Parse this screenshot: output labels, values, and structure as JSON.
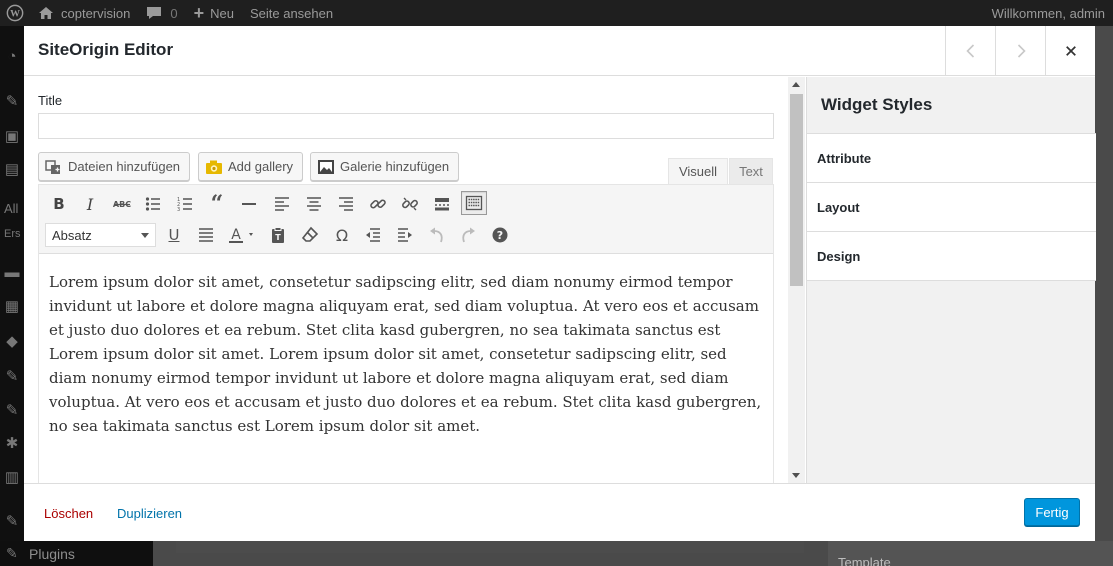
{
  "admin_bar": {
    "site_name": "coptervision",
    "comments_count": "0",
    "new_label": "Neu",
    "view_site_label": "Seite ansehen",
    "greeting": "Willkommen, admin"
  },
  "background": {
    "menu_text_all": "All",
    "menu_text_ers": "Ers",
    "plugins_label": "Plugins",
    "template_label": "Template"
  },
  "modal": {
    "title": "SiteOrigin Editor",
    "title_field": {
      "label": "Title",
      "value": ""
    },
    "media_buttons": {
      "add_media": "Dateien hinzufügen",
      "add_gallery": "Add gallery",
      "add_gallery_de": "Galerie hinzufügen"
    },
    "tabs": {
      "visual": "Visuell",
      "text": "Text"
    },
    "format_select": "Absatz",
    "content": "Lorem ipsum dolor sit amet, consetetur sadipscing elitr, sed diam nonumy eirmod tempor invidunt ut labore et dolore magna aliquyam erat, sed diam voluptua. At vero eos et accusam et justo duo dolores et ea rebum. Stet clita kasd gubergren, no sea takimata sanctus est Lorem ipsum dolor sit amet. Lorem ipsum dolor sit amet, consetetur sadipscing elitr, sed diam nonumy eirmod tempor invidunt ut labore et dolore magna aliquyam erat, sed diam voluptua. At vero eos et accusam et justo duo dolores et ea rebum. Stet clita kasd gubergren, no sea takimata sanctus est Lorem ipsum dolor sit amet.",
    "sidebar": {
      "title": "Widget Styles",
      "sections": [
        "Attribute",
        "Layout",
        "Design"
      ]
    },
    "footer": {
      "delete": "Löschen",
      "duplicate": "Duplizieren",
      "done": "Fertig"
    }
  },
  "icons": {
    "toolbar_row1": [
      "bold-icon",
      "italic-icon",
      "strikethrough-icon",
      "bullet-list-icon",
      "numbered-list-icon",
      "blockquote-icon",
      "horizontal-rule-icon",
      "align-left-icon",
      "align-center-icon",
      "align-right-icon",
      "link-icon",
      "unlink-icon",
      "read-more-icon",
      "toolbar-toggle-icon"
    ],
    "toolbar_row2": [
      "underline-icon",
      "justify-icon",
      "text-color-icon",
      "paste-text-icon",
      "clear-formatting-icon",
      "special-character-icon",
      "outdent-icon",
      "indent-icon",
      "undo-icon",
      "redo-icon",
      "help-icon"
    ]
  },
  "colors": {
    "accent": "#0096dd",
    "delete": "#aa0000",
    "link": "#0073aa"
  }
}
